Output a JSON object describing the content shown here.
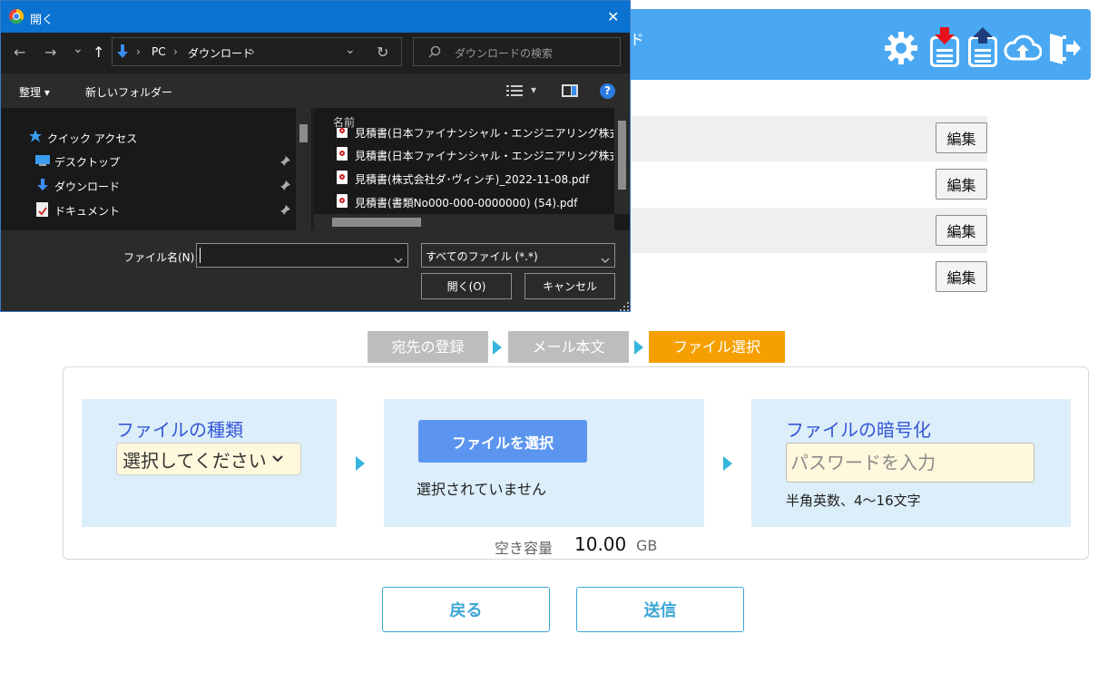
{
  "dialog": {
    "title": "開く",
    "close_glyph": "✕",
    "nav": {
      "back": "←",
      "forward": "→",
      "recent": "⌄",
      "up": "↑",
      "refresh": "↻",
      "dropdown": "⌄"
    },
    "breadcrumb": [
      "PC",
      "ダウンロード"
    ],
    "breadcrumb_sep": "›",
    "search_placeholder": "ダウンロードの検索",
    "organize_label": "整理 ▾",
    "new_folder_label": "新しいフォルダー",
    "view_glyph": "▾",
    "help_glyph": "?",
    "nav_items": [
      {
        "label": "クイック アクセス",
        "icon": "star-icon"
      },
      {
        "label": "デスクトップ",
        "icon": "desktop-icon",
        "pinned": true
      },
      {
        "label": "ダウンロード",
        "icon": "download-icon",
        "pinned": true
      },
      {
        "label": "ドキュメント",
        "icon": "document-icon",
        "pinned": true
      }
    ],
    "column_name": "名前",
    "files": [
      "見積書(日本ファイナンシャル・エンジニアリング株式会社",
      "見積書(日本ファイナンシャル・エンジニアリング株式会社",
      "見積書(株式会社ダ･ヴィンチ)_2022-11-08.pdf",
      "見積書(書類No000-000-0000000) (54).pdf"
    ],
    "filename_label": "ファイル名(N):",
    "filename_value": "",
    "filter_value": "すべてのファイル (*.*)",
    "open_button": "開く(O)",
    "cancel_button": "キャンセル",
    "accent": "#0a72d0"
  },
  "topbar": {
    "color": "#4aa8f2",
    "fragment": "ド",
    "icons": [
      "gear-icon",
      "download-list-icon",
      "upload-list-icon",
      "cloud-upload-icon",
      "logout-icon"
    ]
  },
  "rows": {
    "edit_label": "編集",
    "count": 4
  },
  "steps": {
    "items": [
      {
        "label": "宛先の登録",
        "state": "done"
      },
      {
        "label": "メール本文",
        "state": "done"
      },
      {
        "label": "ファイル選択",
        "state": "active"
      }
    ],
    "active_color": "#f5a000"
  },
  "file_type": {
    "title": "ファイルの種類",
    "select_value": "選択してください",
    "chevron": "⌄"
  },
  "file_select": {
    "button_label": "ファイルを選択",
    "status": "選択されていません"
  },
  "encryption": {
    "title": "ファイルの暗号化",
    "placeholder": "パスワードを入力",
    "hint": "半角英数、4〜16文字"
  },
  "capacity": {
    "label": "空き容量",
    "value": "10.00",
    "unit": "GB"
  },
  "actions": {
    "back": "戻る",
    "send": "送信"
  }
}
